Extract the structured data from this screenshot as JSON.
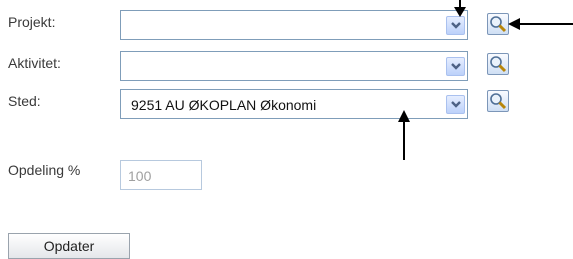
{
  "form": {
    "projekt": {
      "label": "Projekt:",
      "value": ""
    },
    "aktivitet": {
      "label": "Aktivitet:",
      "value": ""
    },
    "sted": {
      "label": "Sted:",
      "value": "9251 AU ØKOPLAN Økonomi"
    },
    "opdeling": {
      "label": "Opdeling %",
      "value": "100"
    }
  },
  "buttons": {
    "update_label": "Opdater"
  },
  "icons": {
    "dropdown": "chevron-down-icon",
    "search": "search-icon",
    "annotation": "arrow-icon"
  },
  "colors": {
    "border": "#7f9db9",
    "dropdown_bg": "#bcd1fa",
    "chevron": "#4d6185",
    "text_disabled": "#a0a0a0"
  }
}
